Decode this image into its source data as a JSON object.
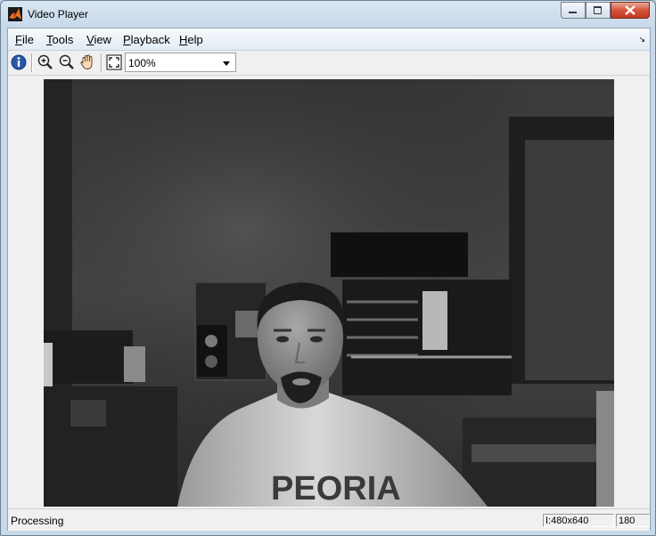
{
  "window": {
    "title": "Video Player"
  },
  "menu": [
    {
      "label": "File",
      "key": "F",
      "rest": "ile"
    },
    {
      "label": "Tools",
      "key": "T",
      "rest": "ools"
    },
    {
      "label": "View",
      "key": "V",
      "rest": "iew"
    },
    {
      "label": "Playback",
      "key": "P",
      "rest": "layback"
    },
    {
      "label": "Help",
      "key": "H",
      "rest": "elp"
    }
  ],
  "toolbar": {
    "info_icon": "info-icon",
    "zoom_in_icon": "zoom-in-icon",
    "zoom_out_icon": "zoom-out-icon",
    "pan_icon": "hand-pan-icon",
    "fit_icon": "fit-to-window-icon",
    "zoom_level": "100%"
  },
  "video": {
    "shirt_text": "PEORIA"
  },
  "status": {
    "text": "Processing",
    "resolution": "I:480x640",
    "frame": "180"
  },
  "colors": {
    "close_button": "#c13a22",
    "frame_bg": "#f0f0f0"
  }
}
